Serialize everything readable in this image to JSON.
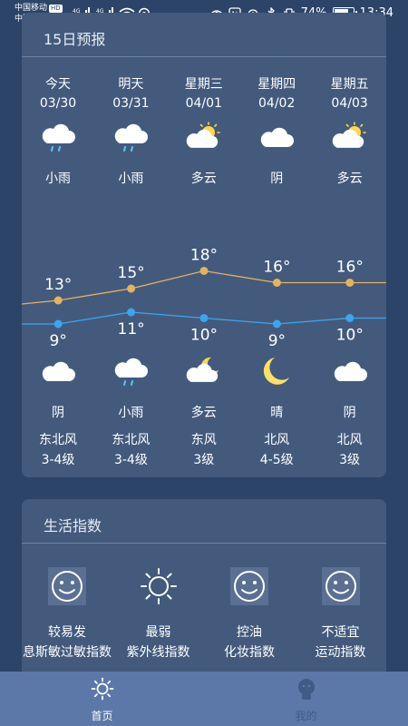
{
  "status_bar": {
    "carrier1": "中国移动",
    "carrier2": "中国联通",
    "hd": "HD",
    "battery": "74%",
    "time": "13:34"
  },
  "forecast": {
    "title": "15日预报",
    "days": [
      {
        "name": "今天",
        "date": "03/30",
        "day_icon": "cloud-rain-icon",
        "day_cond": "小雨",
        "high": 13,
        "high_label": "13°",
        "low": 9,
        "low_label": "9°",
        "night_icon": "cloud-icon",
        "night_cond": "阴",
        "wind_dir": "东北风",
        "wind_level": "3-4级"
      },
      {
        "name": "明天",
        "date": "03/31",
        "day_icon": "cloud-rain-icon",
        "day_cond": "小雨",
        "high": 15,
        "high_label": "15°",
        "low": 11,
        "low_label": "11°",
        "night_icon": "cloud-rain-icon",
        "night_cond": "小雨",
        "wind_dir": "东北风",
        "wind_level": "3-4级"
      },
      {
        "name": "星期三",
        "date": "04/01",
        "day_icon": "sun-cloud-icon",
        "day_cond": "多云",
        "high": 18,
        "high_label": "18°",
        "low": 10,
        "low_label": "10°",
        "night_icon": "moon-cloud-icon",
        "night_cond": "多云",
        "wind_dir": "东风",
        "wind_level": "3级"
      },
      {
        "name": "星期四",
        "date": "04/02",
        "day_icon": "cloud-icon",
        "day_cond": "阴",
        "high": 16,
        "high_label": "16°",
        "low": 9,
        "low_label": "9°",
        "night_icon": "moon-icon",
        "night_cond": "晴",
        "wind_dir": "北风",
        "wind_level": "4-5级"
      },
      {
        "name": "星期五",
        "date": "04/03",
        "day_icon": "sun-cloud-icon",
        "day_cond": "多云",
        "high": 16,
        "high_label": "16°",
        "low": 10,
        "low_label": "10°",
        "night_icon": "cloud-icon",
        "night_cond": "阴",
        "wind_dir": "北风",
        "wind_level": "3级"
      }
    ],
    "colors": {
      "high_line": "#e7b25a",
      "low_line": "#3aa6ef"
    }
  },
  "life_index": {
    "title": "生活指数",
    "items": [
      {
        "icon": "smiley-icon",
        "level": "较易发",
        "name": "息斯敏过敏指数"
      },
      {
        "icon": "sun-outline-icon",
        "level": "最弱",
        "name": "紫外线指数"
      },
      {
        "icon": "smiley-icon",
        "level": "控油",
        "name": "化妆指数"
      },
      {
        "icon": "smiley-icon",
        "level": "不适宜",
        "name": "运动指数"
      }
    ]
  },
  "nav": {
    "home_label": "首页",
    "me_label": "我的"
  }
}
